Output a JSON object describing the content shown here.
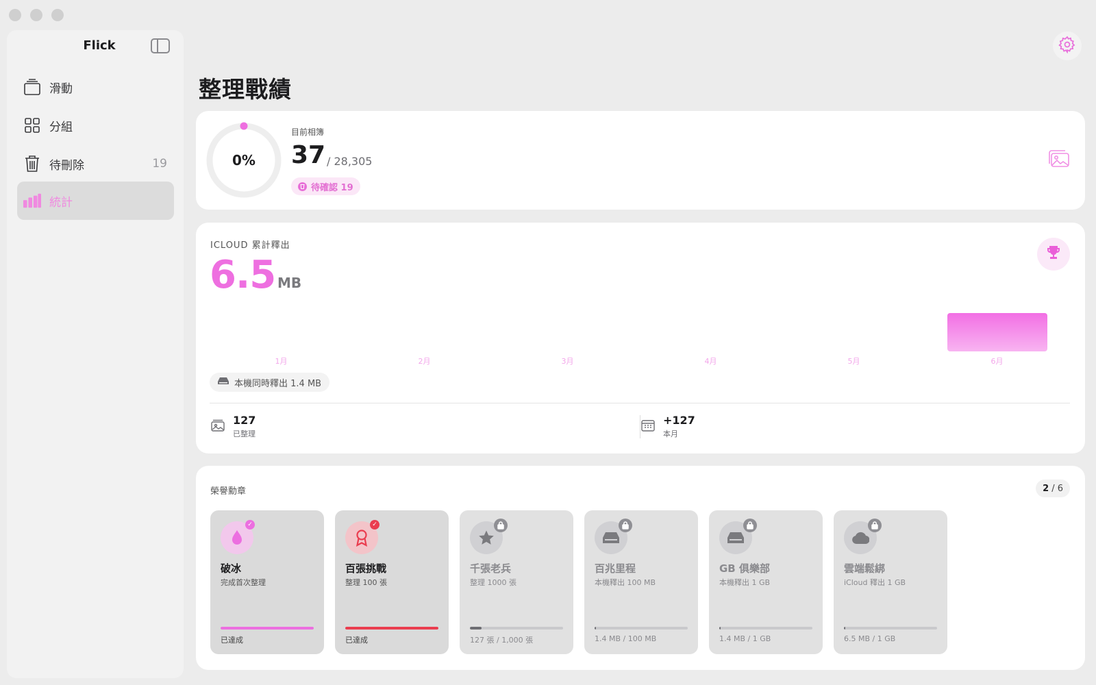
{
  "app": {
    "title": "Flick",
    "accent": "#ee6fe0",
    "icons": {
      "sidebar_toggle": "sidebar-toggle-icon",
      "settings": "gear-icon"
    }
  },
  "sidebar": {
    "items": [
      {
        "label": "滑動",
        "icon": "card-stack-icon",
        "count": ""
      },
      {
        "label": "分組",
        "icon": "grid-icon",
        "count": ""
      },
      {
        "label": "待刪除",
        "icon": "trash-icon",
        "count": "19"
      },
      {
        "label": "統計",
        "icon": "bar-chart-icon",
        "count": "",
        "active": true
      }
    ]
  },
  "page": {
    "title": "整理戰績"
  },
  "album": {
    "percent": "0%",
    "progress": 0,
    "label": "目前相簿",
    "count": "37",
    "total": "/ 28,305",
    "pending_label": "待確認 19",
    "pending_icon": "trash-icon",
    "photos_icon": "photos-icon"
  },
  "icloud": {
    "label": "ICLOUD 累計釋出",
    "value": "6.5",
    "unit": "MB",
    "trophy_icon": "trophy-icon",
    "local_label": "本機同時釋出 1.4 MB",
    "local_icon": "drive-icon",
    "stats": [
      {
        "value": "127",
        "label": "已整理",
        "icon": "photos-icon"
      },
      {
        "value": "+127",
        "label": "本月",
        "icon": "calendar-icon"
      }
    ]
  },
  "chart_data": {
    "type": "bar",
    "categories": [
      "1月",
      "2月",
      "3月",
      "4月",
      "5月",
      "6月"
    ],
    "values": [
      0,
      0,
      0,
      0,
      0,
      6.5
    ],
    "title": "",
    "xlabel": "",
    "ylabel": "",
    "ylim": [
      0,
      6.5
    ],
    "grid": false
  },
  "badges": {
    "label": "榮譽勳章",
    "earned": "2",
    "total": "/ 6",
    "items": [
      {
        "title": "破冰",
        "subtitle": "完成首次整理",
        "status": "已達成",
        "progress": 1.0,
        "earned": true,
        "icon": "droplet-icon",
        "color": "#ec6fe0",
        "bg": "#f2c8ec"
      },
      {
        "title": "百張挑戰",
        "subtitle": "整理 100 張",
        "status": "已達成",
        "progress": 1.0,
        "earned": true,
        "icon": "ribbon-icon",
        "color": "#ea3d4f",
        "bg": "#f3c4c9"
      },
      {
        "title": "千張老兵",
        "subtitle": "整理 1000 張",
        "status": "127 張 / 1,000 張",
        "progress": 0.127,
        "earned": false,
        "icon": "star-icon",
        "color": "#7a7a7e",
        "bg": "#d0d0d3"
      },
      {
        "title": "百兆里程",
        "subtitle": "本機釋出 100 MB",
        "status": "1.4 MB / 100 MB",
        "progress": 0.014,
        "earned": false,
        "icon": "drive-icon",
        "color": "#7a7a7e",
        "bg": "#d0d0d3"
      },
      {
        "title": "GB 俱樂部",
        "subtitle": "本機釋出 1 GB",
        "status": "1.4 MB / 1 GB",
        "progress": 0.0014,
        "earned": false,
        "icon": "drive-icon",
        "color": "#7a7a7e",
        "bg": "#d0d0d3"
      },
      {
        "title": "雲端鬆綁",
        "subtitle": "iCloud 釋出 1 GB",
        "status": "6.5 MB / 1 GB",
        "progress": 0.0065,
        "earned": false,
        "icon": "cloud-icon",
        "color": "#7a7a7e",
        "bg": "#d0d0d3"
      }
    ]
  }
}
